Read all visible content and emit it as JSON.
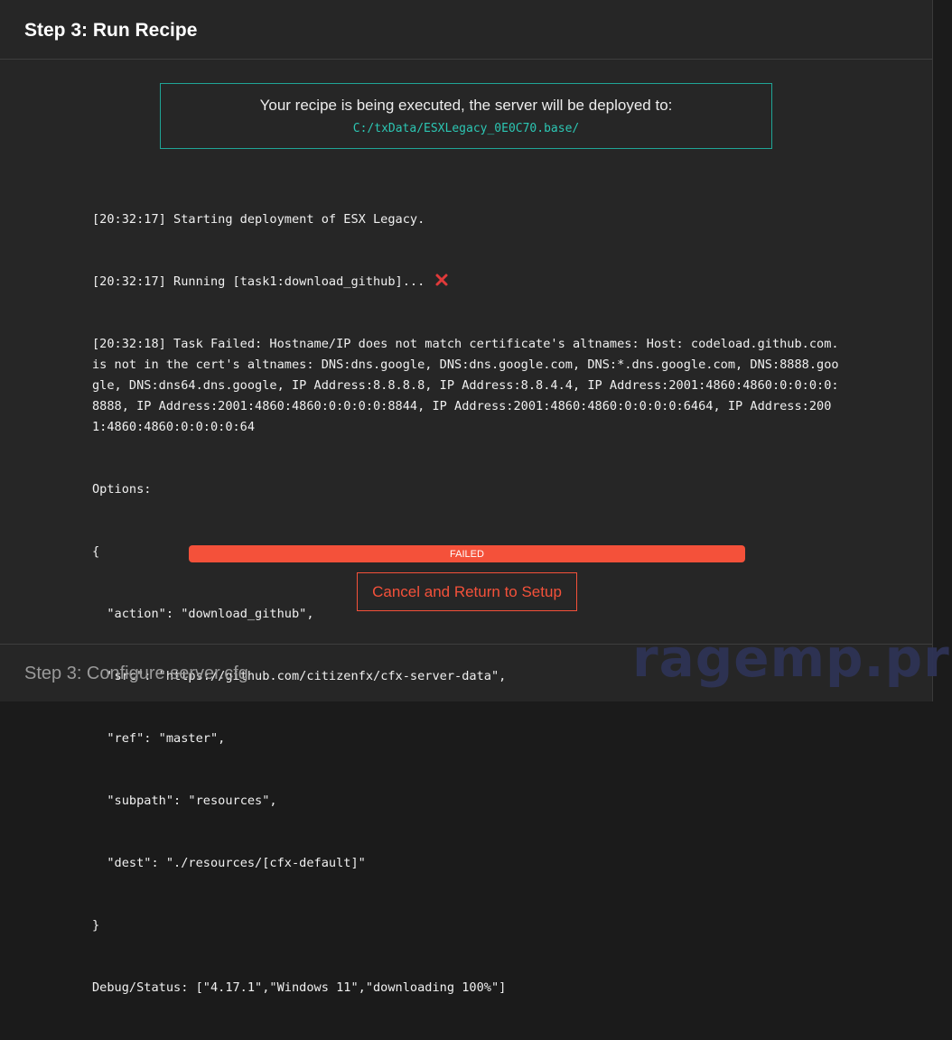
{
  "header": {
    "title": "Step 3: Run Recipe"
  },
  "deploy": {
    "message": "Your recipe is being executed, the server will be deployed to:",
    "path": "C:/txData/ESXLegacy_0E0C70.base/"
  },
  "log": {
    "lines": [
      "[20:32:17] Starting deployment of ESX Legacy.",
      "[20:32:17] Running [task1:download_github]... ",
      "[20:32:18] Task Failed: Hostname/IP does not match certificate's altnames: Host: codeload.github.com. is not in the cert's altnames: DNS:dns.google, DNS:dns.google.com, DNS:*.dns.google.com, DNS:8888.google, DNS:dns64.dns.google, IP Address:8.8.8.8, IP Address:8.8.4.4, IP Address:2001:4860:4860:0:0:0:0:8888, IP Address:2001:4860:4860:0:0:0:0:8844, IP Address:2001:4860:4860:0:0:0:0:6464, IP Address:2001:4860:4860:0:0:0:0:64",
      "Options:",
      "{",
      "  \"action\": \"download_github\",",
      "  \"src\": \"https://github.com/citizenfx/cfx-server-data\",",
      "  \"ref\": \"master\",",
      "  \"subpath\": \"resources\",",
      "  \"dest\": \"./resources/[cfx-default]\"",
      "}",
      "Debug/Status: [\"4.17.1\",\"Windows 11\",\"downloading 100%\"]"
    ],
    "fail_icon": "cross-icon",
    "fail_icon_color": "#e03a3a"
  },
  "progress": {
    "label": "FAILED",
    "value": 1.0,
    "color": "#f4513a"
  },
  "cancel_button": {
    "label": "Cancel and Return to Setup"
  },
  "footer": {
    "title": "Step 3: Configure server.cfg"
  },
  "watermark": {
    "text": "ragemp.pro"
  },
  "colors": {
    "accent": "#1fa596",
    "error": "#f4513a",
    "background": "#262626"
  }
}
